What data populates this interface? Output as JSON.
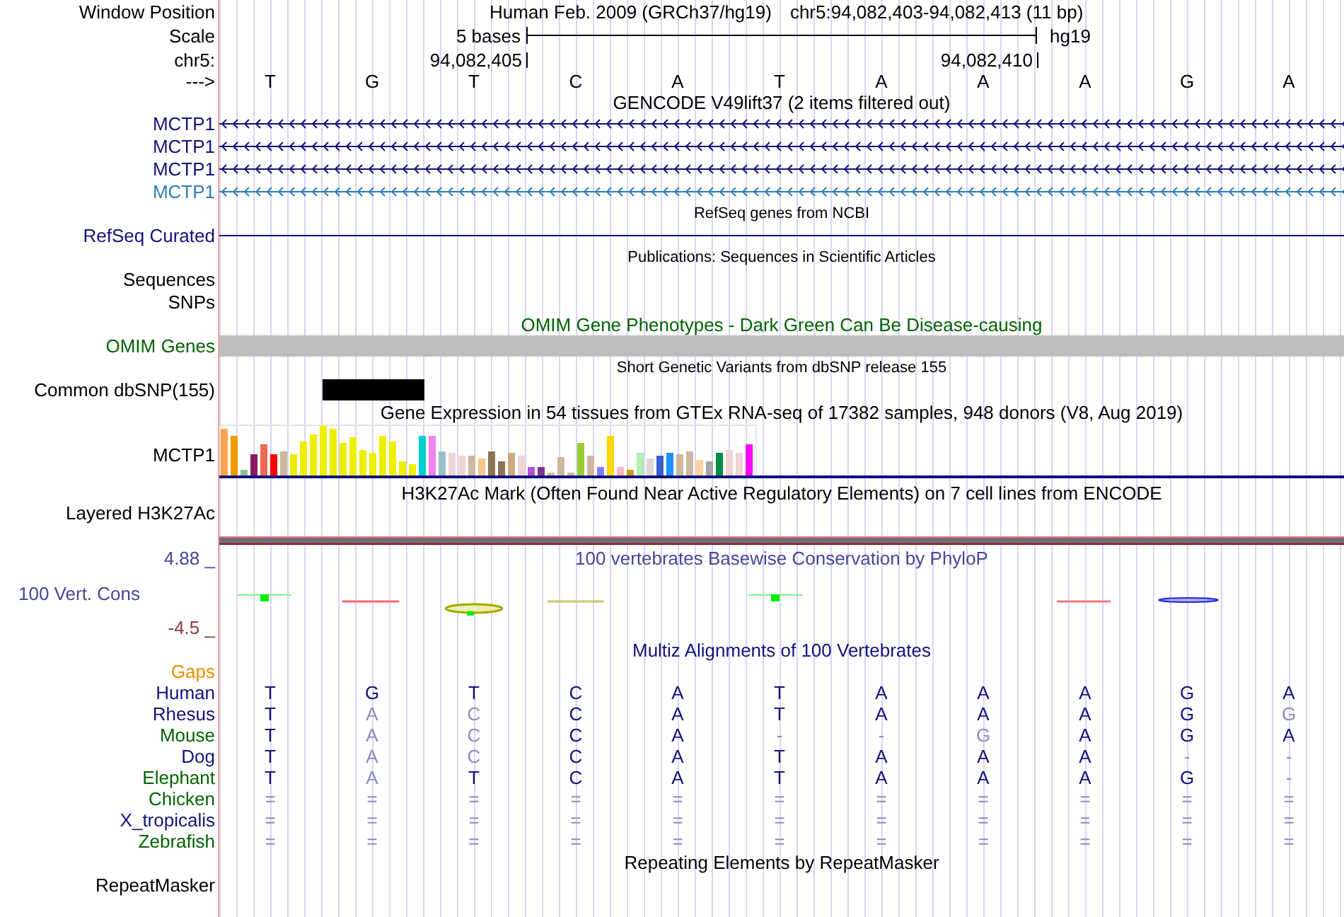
{
  "ruler": {
    "window_label": "Window Position",
    "assembly": "Human Feb. 2009 (GRCh37/hg19)",
    "position": "chr5:94,082,403-94,082,413 (11 bp)",
    "scale_label": "Scale",
    "scale_span": "5 bases",
    "scale_assembly": "hg19",
    "chrom_label": "chr5:",
    "ticks": [
      "94,082,405",
      "94,082,410"
    ],
    "strand_label": "--->",
    "bases": [
      "T",
      "G",
      "T",
      "C",
      "A",
      "T",
      "A",
      "A",
      "A",
      "G",
      "A"
    ]
  },
  "tracks": [
    {
      "kind": "genes",
      "title": "GENCODE V49lift37 (2 items filtered out)",
      "items": [
        {
          "label": "MCTP1",
          "color": "#12127a"
        },
        {
          "label": "MCTP1",
          "color": "#12127a"
        },
        {
          "label": "MCTP1",
          "color": "#12127a"
        },
        {
          "label": "MCTP1",
          "color": "#2f7cb8"
        }
      ]
    },
    {
      "kind": "refseq",
      "title": "RefSeq genes from NCBI",
      "labels": [
        "RefSeq Curated"
      ]
    },
    {
      "kind": "publications",
      "title": "Publications: Sequences in Scientific Articles",
      "labels": [
        "Sequences",
        "SNPs"
      ]
    },
    {
      "kind": "omim",
      "title": "OMIM Gene Phenotypes - Dark Green Can Be Disease-causing",
      "labels": [
        "OMIM Genes"
      ]
    },
    {
      "kind": "dbsnp",
      "title": "Short Genetic Variants from dbSNP release 155",
      "labels": [
        "Common dbSNP(155)"
      ]
    },
    {
      "kind": "gtex",
      "title": "Gene Expression in 54 tissues from GTEx RNA-seq of 17382 samples, 948 donors (V8, Aug 2019)",
      "labels": [
        "MCTP1"
      ]
    },
    {
      "kind": "layered",
      "title": "H3K27Ac Mark (Often Found Near Active Regulatory Elements) on 7 cell lines from ENCODE",
      "labels": [
        "Layered H3K27Ac"
      ]
    },
    {
      "kind": "phylop",
      "title": "100 vertebrates Basewise Conservation by PhyloP",
      "max_label": "4.88 _",
      "labels": [
        "100 Vert. Cons"
      ],
      "min_label": "-4.5 _"
    },
    {
      "kind": "multiz",
      "title": "Multiz Alignments of 100 Vertebrates",
      "labels": [
        "Gaps"
      ],
      "species": [
        {
          "name": "Human",
          "color": "#12127a",
          "bases": [
            {
              "text": "T",
              "dimmed": false
            },
            {
              "text": "G",
              "dimmed": false
            },
            {
              "text": "T",
              "dimmed": false
            },
            {
              "text": "C",
              "dimmed": false
            },
            {
              "text": "A",
              "dimmed": false
            },
            {
              "text": "T",
              "dimmed": false
            },
            {
              "text": "A",
              "dimmed": false
            },
            {
              "text": "A",
              "dimmed": false
            },
            {
              "text": "A",
              "dimmed": false
            },
            {
              "text": "G",
              "dimmed": false
            },
            {
              "text": "A",
              "dimmed": false
            }
          ]
        },
        {
          "name": "Rhesus",
          "color": "#12127a",
          "bases": [
            {
              "text": "T",
              "dimmed": false
            },
            {
              "text": "A",
              "dimmed": true
            },
            {
              "text": "C",
              "dimmed": true
            },
            {
              "text": "C",
              "dimmed": false
            },
            {
              "text": "A",
              "dimmed": false
            },
            {
              "text": "T",
              "dimmed": false
            },
            {
              "text": "A",
              "dimmed": false
            },
            {
              "text": "A",
              "dimmed": false
            },
            {
              "text": "A",
              "dimmed": false
            },
            {
              "text": "G",
              "dimmed": false
            },
            {
              "text": "G",
              "dimmed": true
            }
          ]
        },
        {
          "name": "Mouse",
          "color": "#006400",
          "bases": [
            {
              "text": "T",
              "dimmed": false
            },
            {
              "text": "A",
              "dimmed": true
            },
            {
              "text": "C",
              "dimmed": true
            },
            {
              "text": "C",
              "dimmed": false
            },
            {
              "text": "A",
              "dimmed": false
            },
            {
              "text": "-",
              "dimmed": true
            },
            {
              "text": "-",
              "dimmed": true
            },
            {
              "text": "G",
              "dimmed": true
            },
            {
              "text": "A",
              "dimmed": false
            },
            {
              "text": "G",
              "dimmed": false
            },
            {
              "text": "A",
              "dimmed": false
            }
          ]
        },
        {
          "name": "Dog",
          "color": "#12127a",
          "bases": [
            {
              "text": "T",
              "dimmed": false
            },
            {
              "text": "A",
              "dimmed": true
            },
            {
              "text": "C",
              "dimmed": true
            },
            {
              "text": "C",
              "dimmed": false
            },
            {
              "text": "A",
              "dimmed": false
            },
            {
              "text": "T",
              "dimmed": false
            },
            {
              "text": "A",
              "dimmed": false
            },
            {
              "text": "A",
              "dimmed": false
            },
            {
              "text": "A",
              "dimmed": false
            },
            {
              "text": "-",
              "dimmed": true
            },
            {
              "text": "-",
              "dimmed": true
            }
          ]
        },
        {
          "name": "Elephant",
          "color": "#006400",
          "bases": [
            {
              "text": "T",
              "dimmed": false
            },
            {
              "text": "A",
              "dimmed": true
            },
            {
              "text": "T",
              "dimmed": false
            },
            {
              "text": "C",
              "dimmed": false
            },
            {
              "text": "A",
              "dimmed": false
            },
            {
              "text": "T",
              "dimmed": false
            },
            {
              "text": "A",
              "dimmed": false
            },
            {
              "text": "A",
              "dimmed": false
            },
            {
              "text": "A",
              "dimmed": false
            },
            {
              "text": "G",
              "dimmed": false
            },
            {
              "text": "-",
              "dimmed": true
            }
          ]
        },
        {
          "name": "Chicken",
          "color": "#006400",
          "bases": [
            {
              "text": "=",
              "dimmed": true
            },
            {
              "text": "=",
              "dimmed": true
            },
            {
              "text": "=",
              "dimmed": true
            },
            {
              "text": "=",
              "dimmed": true
            },
            {
              "text": "=",
              "dimmed": true
            },
            {
              "text": "=",
              "dimmed": true
            },
            {
              "text": "=",
              "dimmed": true
            },
            {
              "text": "=",
              "dimmed": true
            },
            {
              "text": "=",
              "dimmed": true
            },
            {
              "text": "=",
              "dimmed": true
            },
            {
              "text": "=",
              "dimmed": true
            }
          ]
        },
        {
          "name": "X_tropicalis",
          "color": "#12127a",
          "bases": [
            {
              "text": "=",
              "dimmed": true
            },
            {
              "text": "=",
              "dimmed": true
            },
            {
              "text": "=",
              "dimmed": true
            },
            {
              "text": "=",
              "dimmed": true
            },
            {
              "text": "=",
              "dimmed": true
            },
            {
              "text": "=",
              "dimmed": true
            },
            {
              "text": "=",
              "dimmed": true
            },
            {
              "text": "=",
              "dimmed": true
            },
            {
              "text": "=",
              "dimmed": true
            },
            {
              "text": "=",
              "dimmed": true
            },
            {
              "text": "=",
              "dimmed": true
            }
          ]
        },
        {
          "name": "Zebrafish",
          "color": "#006400",
          "bases": [
            {
              "text": "=",
              "dimmed": true
            },
            {
              "text": "=",
              "dimmed": true
            },
            {
              "text": "=",
              "dimmed": true
            },
            {
              "text": "=",
              "dimmed": true
            },
            {
              "text": "=",
              "dimmed": true
            },
            {
              "text": "=",
              "dimmed": true
            },
            {
              "text": "=",
              "dimmed": true
            },
            {
              "text": "=",
              "dimmed": true
            },
            {
              "text": "=",
              "dimmed": true
            },
            {
              "text": "=",
              "dimmed": true
            },
            {
              "text": "=",
              "dimmed": true
            }
          ]
        }
      ]
    },
    {
      "kind": "repeatmasker",
      "title": "Repeating Elements by RepeatMasker",
      "labels": [
        "RepeatMasker"
      ]
    }
  ]
}
